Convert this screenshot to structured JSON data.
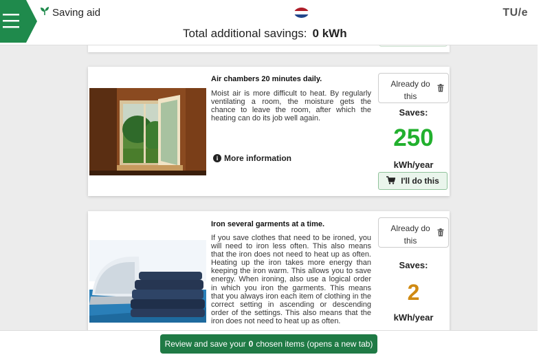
{
  "header": {
    "app_name": "Saving aid",
    "total_label": "Total additional savings:",
    "total_value": "0 kWh",
    "logo_text": "TU/e",
    "language_flag": "netherlands-flag"
  },
  "measures": [
    {
      "title": "Air chambers 20 minutes daily.",
      "description": "Moist air is more difficult to heat. By regularly ventilating a room, the moisture gets the chance to leave the room, after which the heating can do its job well again.",
      "more_info_label": "More information",
      "already_label": "Already do this",
      "saves_label": "Saves:",
      "saves_value": "250",
      "saves_unit": "kWh/year",
      "saves_color": "#22b02e",
      "do_label": "I'll do this",
      "image": "open-window-photo"
    },
    {
      "title": "Iron several garments at a time.",
      "description": "If you save clothes that need to be ironed, you will need to iron less often. This also means that the iron does not need to heat up as often. Heating up the iron takes more energy than keeping the iron warm. This allows you to save energy. When ironing, also use a logical order in which you iron the garments. This means that you always iron each item of clothing in the correct setting in ascending or descending order of the settings. This also means that the iron does not need to heat up as often.",
      "already_label": "Already do this",
      "saves_label": "Saves:",
      "saves_value": "2",
      "saves_unit": "kWh/year",
      "saves_color": "#d08a12",
      "image": "iron-and-clothes-photo"
    }
  ],
  "footer": {
    "review_prefix": "Review and save your",
    "review_count": "0",
    "review_suffix": "chosen items  (opens a new tab)"
  },
  "colors": {
    "brand_green": "#1f8a4c",
    "button_green": "#1f7a45"
  }
}
